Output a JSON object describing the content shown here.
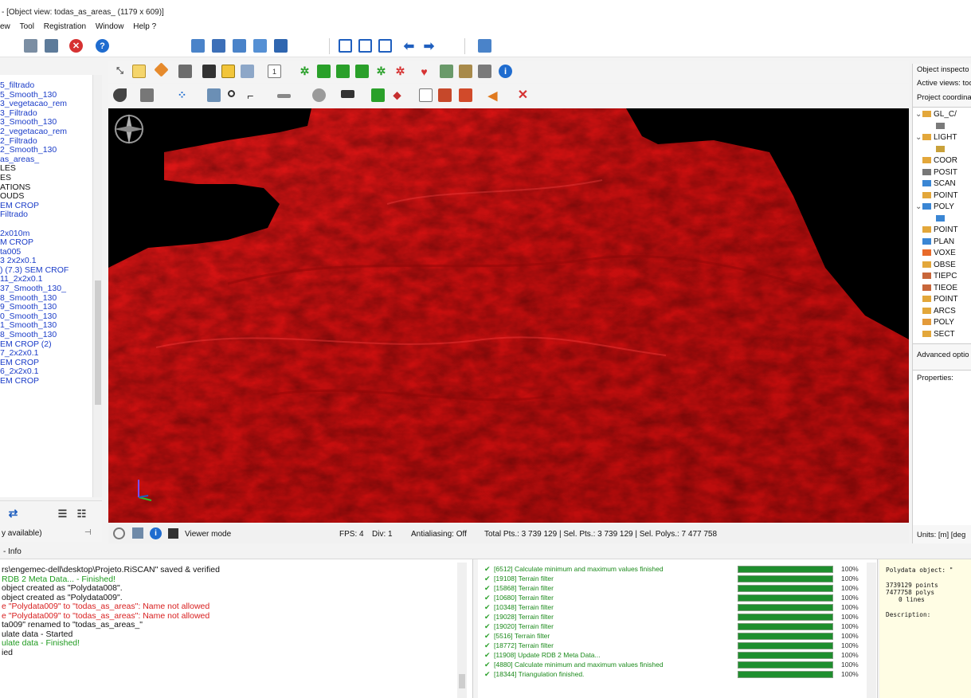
{
  "title_bar": {
    "text": "- [Object view: todas_as_areas_ (1179 x 609)]"
  },
  "menu": [
    "ew",
    "Tool",
    "Registration",
    "Window",
    "Help ?"
  ],
  "colors": {
    "terrain": "#d61414",
    "link": "#1a3cc8",
    "error": "#d81e1e",
    "success": "#1f9a1f",
    "progress": "#1e8f2e"
  },
  "left_panel": {
    "items": [
      {
        "label": "5_filtrado",
        "color": "link"
      },
      {
        "label": "5_Smooth_130",
        "color": "link"
      },
      {
        "label": "3_vegetacao_rem",
        "color": "link"
      },
      {
        "label": "3_Filtrado",
        "color": "link"
      },
      {
        "label": "3_Smooth_130",
        "color": "link"
      },
      {
        "label": "2_vegetacao_rem",
        "color": "link"
      },
      {
        "label": "2_Filtrado",
        "color": "link"
      },
      {
        "label": "2_Smooth_130",
        "color": "link"
      },
      {
        "label": "as_areas_",
        "color": "link"
      },
      {
        "label": "LES",
        "color": "black"
      },
      {
        "label": "ES",
        "color": "black"
      },
      {
        "label": "ATIONS",
        "color": "black"
      },
      {
        "label": "OUDS",
        "color": "black"
      },
      {
        "label": "EM CROP",
        "color": "link"
      },
      {
        "label": "Filtrado",
        "color": "link"
      },
      {
        "label": "",
        "color": "link"
      },
      {
        "label": "2x010m",
        "color": "link"
      },
      {
        "label": "M CROP",
        "color": "link"
      },
      {
        "label": "ta005",
        "color": "link"
      },
      {
        "label": "3 2x2x0.1",
        "color": "link"
      },
      {
        "label": ") (7.3) SEM CROF",
        "color": "link"
      },
      {
        "label": "11_2x2x0.1",
        "color": "link"
      },
      {
        "label": "37_Smooth_130_",
        "color": "link"
      },
      {
        "label": "8_Smooth_130",
        "color": "link"
      },
      {
        "label": "9_Smooth_130",
        "color": "link"
      },
      {
        "label": "0_Smooth_130",
        "color": "link"
      },
      {
        "label": "1_Smooth_130",
        "color": "link"
      },
      {
        "label": "8_Smooth_130",
        "color": "link"
      },
      {
        "label": "EM CROP (2)",
        "color": "link"
      },
      {
        "label": "7_2x2x0.1",
        "color": "link"
      },
      {
        "label": "EM CROP",
        "color": "link"
      },
      {
        "label": "6_2x2x0.1",
        "color": "link"
      },
      {
        "label": "EM CROP",
        "color": "link"
      }
    ],
    "status": "y available)"
  },
  "viewer_status": {
    "mode": "Viewer mode",
    "fps": "FPS: 4",
    "div": "Div: 1",
    "antialiasing": "Antialiasing: Off",
    "stats": "Total Pts.: 3 739 129 | Sel. Pts.: 3 739 129 | Sel. Polys.: 7 477 758"
  },
  "right_panel": {
    "object_inspector": "Object inspecto",
    "active_views": "Active views: too",
    "project_coords": "Project coordina",
    "tree": [
      {
        "label": "GL_C/",
        "chev": "v",
        "indent": 0
      },
      {
        "label": "",
        "chev": "",
        "indent": 1
      },
      {
        "label": "LIGHT",
        "chev": "v",
        "indent": 0
      },
      {
        "label": "",
        "chev": "",
        "indent": 1
      },
      {
        "label": "COOR",
        "chev": "",
        "indent": 0
      },
      {
        "label": "POSIT",
        "chev": "",
        "indent": 0
      },
      {
        "label": "SCAN",
        "chev": "",
        "indent": 0
      },
      {
        "label": "POINT",
        "chev": "",
        "indent": 0
      },
      {
        "label": "POLY",
        "chev": "v",
        "indent": 0
      },
      {
        "label": "",
        "chev": "",
        "indent": 1
      },
      {
        "label": "POINT",
        "chev": "",
        "indent": 0
      },
      {
        "label": "PLAN",
        "chev": "",
        "indent": 0
      },
      {
        "label": "VOXE",
        "chev": "",
        "indent": 0
      },
      {
        "label": "OBSE",
        "chev": "",
        "indent": 0
      },
      {
        "label": "TIEPC",
        "chev": "",
        "indent": 0
      },
      {
        "label": "TIEOE",
        "chev": "",
        "indent": 0
      },
      {
        "label": "POINT",
        "chev": "",
        "indent": 0
      },
      {
        "label": "ARCS",
        "chev": "",
        "indent": 0
      },
      {
        "label": "POLY",
        "chev": "",
        "indent": 0
      },
      {
        "label": "SECT",
        "chev": "",
        "indent": 0
      }
    ],
    "advanced": "Advanced optio",
    "properties": "Properties:",
    "units": "Units: [m] [deg"
  },
  "info_tab": {
    "label": "- Info"
  },
  "log": [
    {
      "text": "rs\\engemec-dell\\desktop\\Projeto.RiSCAN\" saved & verified",
      "color": "black"
    },
    {
      "text": "RDB 2 Meta Data... - Finished!",
      "color": "success"
    },
    {
      "text": "object created as \"Polydata008\".",
      "color": "black"
    },
    {
      "text": "object created as \"Polydata009\".",
      "color": "black"
    },
    {
      "text": "e \"Polydata009\" to \"todas_as_areas\": Name not allowed",
      "color": "error"
    },
    {
      "text": "e \"Polydata009\" to \"todas_as_areas\": Name not allowed",
      "color": "error"
    },
    {
      "text": "ta009\" renamed to \"todas_as_areas_\"",
      "color": "black"
    },
    {
      "text": "ulate data - Started",
      "color": "black"
    },
    {
      "text": "ulate data - Finished!",
      "color": "success"
    },
    {
      "text": "ied",
      "color": "black"
    }
  ],
  "tasks": [
    {
      "text": "[6512] Calculate minimum and maximum values finished",
      "progress": 1.0,
      "pct": "100%"
    },
    {
      "text": "[19108] Terrain filter",
      "progress": 1.0,
      "pct": "100%"
    },
    {
      "text": "[15868] Terrain filter",
      "progress": 1.0,
      "pct": "100%"
    },
    {
      "text": "[10680] Terrain filter",
      "progress": 1.0,
      "pct": "100%"
    },
    {
      "text": "[10348] Terrain filter",
      "progress": 1.0,
      "pct": "100%"
    },
    {
      "text": "[19028] Terrain filter",
      "progress": 1.0,
      "pct": "100%"
    },
    {
      "text": "[19020] Terrain filter",
      "progress": 1.0,
      "pct": "100%"
    },
    {
      "text": "[5516] Terrain filter",
      "progress": 1.0,
      "pct": "100%"
    },
    {
      "text": "[18772] Terrain filter",
      "progress": 1.0,
      "pct": "100%"
    },
    {
      "text": "[11908] Update RDB 2 Meta Data...",
      "progress": 1.0,
      "pct": "100%"
    },
    {
      "text": "[4880] Calculate minimum and maximum values finished",
      "progress": 1.0,
      "pct": "100%"
    },
    {
      "text": "[18344] Triangulation finished.",
      "progress": 1.0,
      "pct": "100%"
    }
  ],
  "description_panel": {
    "header": "Polydata object: \"",
    "points": "3739129 points",
    "polys": "7477758 polys",
    "lines": "0 lines",
    "description": "Description:"
  }
}
